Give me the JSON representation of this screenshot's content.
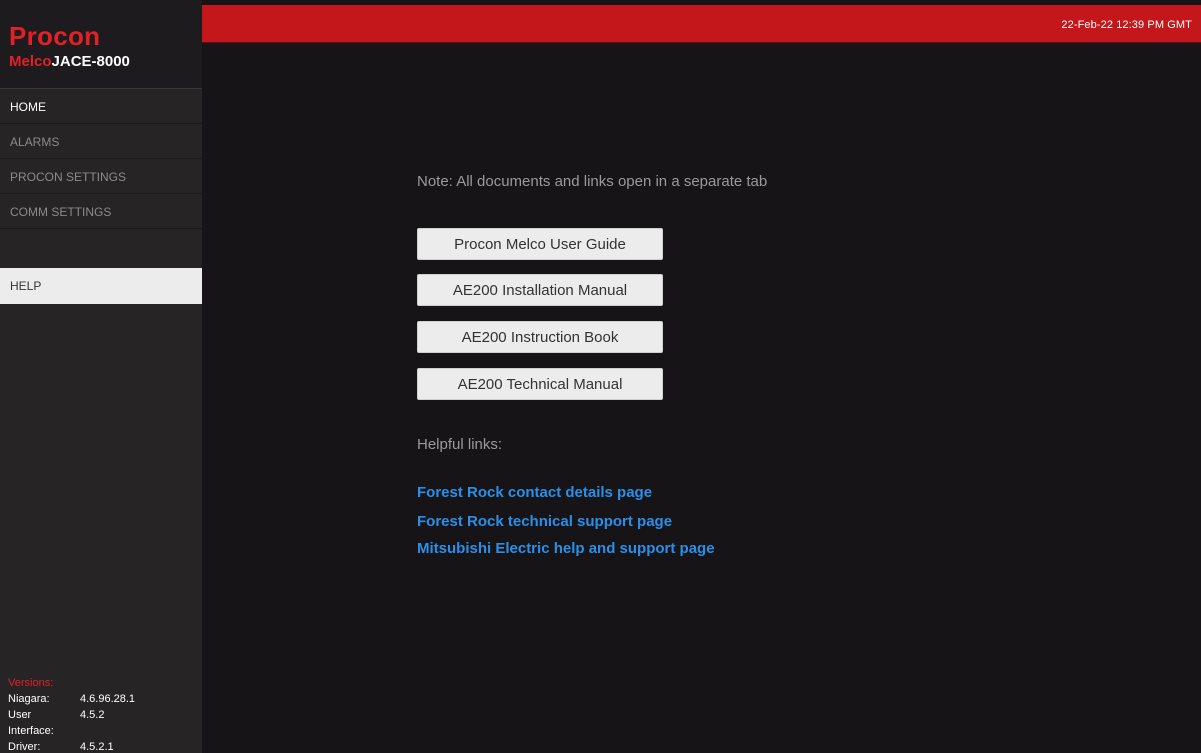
{
  "header": {
    "datetime": "22-Feb-22 12:39 PM GMT"
  },
  "brand": {
    "name": "Procon",
    "model_prefix": "Melco",
    "model_suffix": "JACE-8000"
  },
  "sidebar": {
    "items": [
      {
        "label": "HOME"
      },
      {
        "label": "ALARMS"
      },
      {
        "label": "PROCON SETTINGS"
      },
      {
        "label": "COMM SETTINGS"
      }
    ],
    "help_label": "HELP"
  },
  "versions": {
    "title": "Versions:",
    "rows": [
      {
        "key": "Niagara:",
        "value": "4.6.96.28.1"
      },
      {
        "key": "User Interface:",
        "value": "4.5.2"
      },
      {
        "key": "Driver:",
        "value": "4.5.2.1"
      }
    ]
  },
  "main": {
    "note": "Note: All documents and links open in a separate tab",
    "documents": [
      {
        "label": "Procon Melco User Guide"
      },
      {
        "label": "AE200 Installation Manual"
      },
      {
        "label": "AE200 Instruction Book"
      },
      {
        "label": "AE200 Technical Manual"
      }
    ],
    "helpful_title": "Helpful links:",
    "links": [
      {
        "label": "Forest Rock contact details page"
      },
      {
        "label": "Forest Rock technical support page"
      },
      {
        "label": "Mitsubishi Electric help and support page"
      }
    ]
  },
  "colors": {
    "accent_red": "#c4171b",
    "brand_red": "#e02126",
    "link_blue": "#2b8fea",
    "background": "#161416",
    "sidebar": "#272426"
  }
}
